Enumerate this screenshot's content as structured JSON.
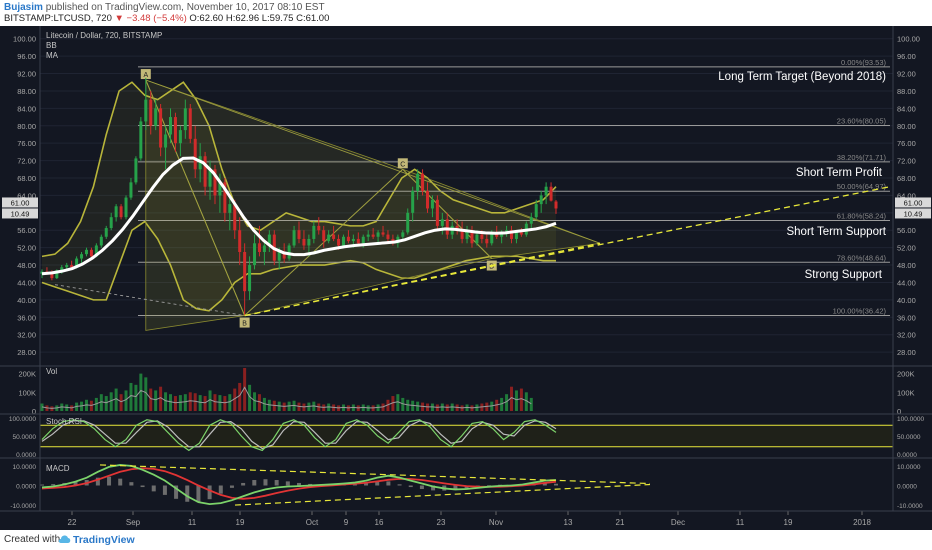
{
  "header": {
    "author": "Bujasim",
    "published": "published on TradingView.com, November 10, 2017 08:10 EST",
    "symbol_line": "BITSTAMP:LTCUSD, 720",
    "change": "▼ −3.48 (−5.4%)",
    "ohlc": "O:62.60 H:62.96 L:59.75 C:61.00"
  },
  "footer": {
    "created_with": "Created with",
    "brand": "TradingView"
  },
  "chart_data": [
    {
      "type": "line",
      "title": "Litecoin / Dollar, 720, BITSTAMP",
      "indicators": [
        "BB",
        "MA"
      ],
      "y_ticks": [
        "100.00",
        "96.00",
        "92.00",
        "88.00",
        "84.00",
        "80.00",
        "76.00",
        "72.00",
        "68.00",
        "64.00",
        "60.00",
        "56.00",
        "52.00",
        "48.00",
        "44.00",
        "40.00",
        "36.00",
        "32.00",
        "28.00"
      ],
      "ylim": [
        25.5,
        102
      ],
      "x_ticks": [
        "22",
        "Sep",
        "11",
        "19",
        "Oct",
        "9",
        "16",
        "23",
        "Nov",
        "13",
        "21",
        "Dec",
        "11",
        "19",
        "2018"
      ],
      "price_labels": {
        "last": "61.00",
        "ma": "10.49"
      },
      "fib_levels": [
        {
          "label": "0.00%(93.53)",
          "value": 93.53
        },
        {
          "label": "23.60%(80.05)",
          "value": 80.05
        },
        {
          "label": "38.20%(71.71)",
          "value": 71.71
        },
        {
          "label": "50.00%(64.97)",
          "value": 64.97
        },
        {
          "label": "61.80%(58.24)",
          "value": 58.24
        },
        {
          "label": "78.60%(48.64)",
          "value": 48.64
        },
        {
          "label": "100.00%(36.42)",
          "value": 36.42
        }
      ],
      "annotations": {
        "long_term": "Long Term Target (Beyond 2018)",
        "short_profit": "Short Term Profit",
        "short_support": "Short Term Support",
        "strong_support": "Strong Support"
      },
      "pattern_points": [
        {
          "label": "A",
          "value": 90.5
        },
        {
          "label": "B",
          "value": 36.4
        },
        {
          "label": "C",
          "value": 70.0
        },
        {
          "label": "D",
          "value": 49.5
        }
      ],
      "candles": [
        [
          46,
          47,
          45,
          46.5
        ],
        [
          46.5,
          47.5,
          45.8,
          46
        ],
        [
          46,
          46.8,
          44.5,
          45
        ],
        [
          45,
          47,
          44.8,
          46.8
        ],
        [
          46.8,
          48,
          46,
          47.5
        ],
        [
          47.5,
          48.5,
          47,
          48
        ],
        [
          48,
          49,
          47,
          47.5
        ],
        [
          47.5,
          50,
          47.2,
          49.5
        ],
        [
          49.5,
          51,
          48.5,
          50.5
        ],
        [
          50.5,
          52,
          50,
          51.5
        ],
        [
          51.5,
          52,
          49.5,
          50
        ],
        [
          50,
          53,
          49.8,
          52.5
        ],
        [
          52.5,
          55,
          52,
          54.5
        ],
        [
          54.5,
          57,
          54,
          56.5
        ],
        [
          56.5,
          60,
          56,
          59
        ],
        [
          59,
          62,
          58,
          61.5
        ],
        [
          61.5,
          62,
          58.5,
          59
        ],
        [
          59,
          64,
          58.5,
          63.5
        ],
        [
          63.5,
          68,
          63,
          67
        ],
        [
          67,
          73,
          66.5,
          72.5
        ],
        [
          72.5,
          82,
          72,
          81
        ],
        [
          81,
          91,
          79,
          86
        ],
        [
          86,
          88,
          78,
          80
        ],
        [
          80,
          86,
          79,
          84
        ],
        [
          84,
          85,
          73,
          75
        ],
        [
          75,
          80,
          70,
          78
        ],
        [
          78,
          84,
          76,
          82
        ],
        [
          82,
          83,
          74,
          76
        ],
        [
          76,
          80,
          73,
          79
        ],
        [
          79,
          86,
          77,
          84
        ],
        [
          84,
          85,
          76,
          77
        ],
        [
          77,
          80,
          68,
          70
        ],
        [
          70,
          76,
          67,
          73
        ],
        [
          73,
          74,
          64,
          66
        ],
        [
          66,
          72,
          63,
          70
        ],
        [
          70,
          71,
          62,
          64
        ],
        [
          64,
          69,
          60,
          67
        ],
        [
          67,
          68,
          58,
          60
        ],
        [
          60,
          64,
          56,
          62
        ],
        [
          62,
          63,
          54,
          56
        ],
        [
          56,
          59,
          48,
          51
        ],
        [
          51,
          53,
          36.4,
          42
        ],
        [
          42,
          50,
          40,
          48
        ],
        [
          48,
          55,
          47,
          53
        ],
        [
          53,
          57,
          50,
          51
        ],
        [
          51,
          54,
          48,
          52.5
        ],
        [
          52.5,
          56,
          51,
          55
        ],
        [
          55,
          56,
          48,
          49
        ],
        [
          49,
          52,
          47,
          51
        ],
        [
          51,
          53,
          48.5,
          49.5
        ],
        [
          49.5,
          53,
          49,
          52.5
        ],
        [
          52.5,
          57,
          52,
          56
        ],
        [
          56,
          58,
          53,
          54
        ],
        [
          54,
          56,
          51.5,
          52.5
        ],
        [
          52.5,
          55,
          50,
          54
        ],
        [
          54,
          58,
          53,
          57
        ],
        [
          57,
          59,
          55,
          56
        ],
        [
          56,
          57,
          52,
          53.5
        ],
        [
          53.5,
          56,
          53,
          55
        ],
        [
          55,
          57,
          53.5,
          54
        ],
        [
          54,
          55,
          51.5,
          52.5
        ],
        [
          52.5,
          55,
          52,
          54.5
        ],
        [
          54.5,
          56,
          53,
          53.5
        ],
        [
          53.5,
          55,
          52,
          54
        ],
        [
          54,
          55.5,
          52.5,
          53
        ],
        [
          53,
          55,
          52,
          54.5
        ],
        [
          54.5,
          56,
          53.5,
          55
        ],
        [
          55,
          56.5,
          54,
          54.5
        ],
        [
          54.5,
          56,
          53,
          55.5
        ],
        [
          55.5,
          57,
          54.5,
          55
        ],
        [
          55,
          56,
          53,
          54
        ],
        [
          54,
          55,
          52.5,
          53
        ],
        [
          53,
          55,
          52,
          54.5
        ],
        [
          54.5,
          56,
          54,
          55.5
        ],
        [
          55.5,
          61,
          55,
          60
        ],
        [
          60,
          66,
          58,
          65
        ],
        [
          65,
          70,
          63,
          69
        ],
        [
          69,
          70,
          64,
          65
        ],
        [
          65,
          67,
          60,
          61
        ],
        [
          61,
          64,
          59,
          63
        ],
        [
          63,
          64,
          56,
          57
        ],
        [
          57,
          60,
          55,
          58.5
        ],
        [
          58.5,
          60,
          54,
          55
        ],
        [
          55,
          58,
          54,
          57
        ],
        [
          57,
          58.5,
          55,
          56
        ],
        [
          56,
          58,
          53,
          54
        ],
        [
          54,
          57,
          53,
          56
        ],
        [
          56,
          57,
          52,
          53
        ],
        [
          53,
          56,
          52.5,
          55
        ],
        [
          55,
          56,
          53,
          54
        ],
        [
          54,
          55,
          52,
          53
        ],
        [
          53,
          56,
          52.5,
          55.5
        ],
        [
          55.5,
          57,
          54,
          54.5
        ],
        [
          54.5,
          56,
          53,
          55.5
        ],
        [
          55.5,
          57,
          54.5,
          56
        ],
        [
          56,
          57,
          53,
          54
        ],
        [
          54,
          56,
          53,
          55.5
        ],
        [
          55.5,
          56.5,
          54.5,
          55
        ],
        [
          55,
          58,
          54.5,
          57.5
        ],
        [
          57.5,
          60,
          56.5,
          59
        ],
        [
          59,
          63,
          58.5,
          62
        ],
        [
          62,
          65,
          60,
          64
        ],
        [
          64,
          67,
          62,
          66
        ],
        [
          66,
          67,
          62.6,
          62.8
        ],
        [
          62.6,
          62.96,
          59.75,
          61
        ]
      ],
      "ma": [
        46,
        46.2,
        46.6,
        47.2,
        48.2,
        49.6,
        51.4,
        53.6,
        56.2,
        59.2,
        62.5,
        65.8,
        68.8,
        71,
        72.5,
        72.6,
        71.5,
        69.2,
        66,
        62.5,
        59,
        56,
        53.6,
        51.8,
        50.8,
        50.4,
        50.4,
        50.8,
        51.4,
        51.8,
        52.2,
        52.5,
        52.7,
        52.9,
        53.1,
        53.3,
        53.8,
        54.6,
        55.4,
        56,
        56.3,
        56.2,
        55.9,
        55.6,
        55.4,
        55.3,
        55.4,
        55.7,
        56,
        56.3,
        56.8,
        57.6
      ],
      "bb_upper": [
        50,
        50.5,
        53,
        58,
        66,
        78,
        88,
        90,
        87,
        86,
        88,
        90,
        86,
        80,
        70,
        62,
        57,
        56,
        58,
        60,
        59,
        58,
        58,
        57.5,
        57,
        57,
        58,
        63,
        68,
        70,
        68,
        65,
        63,
        62,
        61,
        60,
        60,
        61,
        62,
        63,
        66
      ],
      "bb_lower": [
        44,
        43,
        42,
        41,
        40,
        40,
        48,
        56,
        58,
        54,
        48,
        40,
        38,
        37.5,
        40,
        44,
        46,
        46,
        47,
        47.5,
        48,
        48,
        48,
        48.5,
        49,
        48.5,
        47,
        46,
        45,
        45,
        46,
        47,
        48,
        49,
        49.5,
        50,
        50,
        50,
        49.5,
        49,
        49
      ],
      "trend_start_value": 43.5
    },
    {
      "type": "bar",
      "title": "Vol",
      "y_ticks": [
        "200K",
        "100K",
        "0"
      ],
      "ylim": [
        0,
        230000
      ],
      "values": [
        40000,
        30000,
        25000,
        30000,
        40000,
        35000,
        30000,
        45000,
        50000,
        60000,
        55000,
        70000,
        90000,
        80000,
        100000,
        120000,
        90000,
        110000,
        150000,
        140000,
        200000,
        180000,
        120000,
        110000,
        130000,
        100000,
        90000,
        80000,
        85000,
        90000,
        100000,
        95000,
        85000,
        80000,
        110000,
        90000,
        85000,
        80000,
        90000,
        120000,
        150000,
        230000,
        140000,
        100000,
        90000,
        70000,
        60000,
        55000,
        50000,
        45000,
        50000,
        55000,
        45000,
        40000,
        45000,
        50000,
        40000,
        35000,
        40000,
        35000,
        30000,
        35000,
        30000,
        35000,
        30000,
        35000,
        30000,
        30000,
        35000,
        40000,
        60000,
        80000,
        90000,
        70000,
        60000,
        55000,
        50000,
        45000,
        40000,
        40000,
        35000,
        40000,
        35000,
        40000,
        35000,
        30000,
        35000,
        30000,
        35000,
        40000,
        45000,
        50000,
        60000,
        70000,
        90000,
        130000,
        110000,
        120000,
        100000,
        70000
      ]
    },
    {
      "type": "line",
      "title": "Stoch RSI",
      "y_ticks": [
        "100.0000",
        "50.0000",
        "0.0000"
      ],
      "ylim": [
        0,
        100
      ],
      "levels": [
        80,
        20
      ],
      "k": [
        40,
        70,
        90,
        95,
        90,
        70,
        40,
        20,
        40,
        80,
        95,
        90,
        60,
        30,
        10,
        30,
        80,
        95,
        85,
        50,
        20,
        10,
        40,
        85,
        95,
        80,
        45,
        20,
        40,
        85,
        95,
        80,
        50,
        30,
        60,
        90,
        95,
        75,
        40,
        20,
        50,
        85,
        90,
        70,
        40,
        60,
        90,
        95,
        80,
        60
      ],
      "d": [
        35,
        55,
        80,
        92,
        92,
        80,
        55,
        30,
        30,
        60,
        88,
        92,
        75,
        45,
        20,
        20,
        55,
        88,
        90,
        70,
        35,
        15,
        25,
        65,
        90,
        88,
        60,
        30,
        30,
        65,
        90,
        88,
        65,
        40,
        45,
        78,
        92,
        85,
        55,
        30,
        35,
        70,
        88,
        80,
        55,
        50,
        80,
        92,
        88,
        70
      ]
    },
    {
      "type": "line",
      "title": "MACD",
      "y_ticks": [
        "10.0000",
        "0.0000",
        "-10.0000"
      ],
      "ylim": [
        -12,
        12
      ],
      "macd": [
        -1,
        -0.5,
        0.5,
        2,
        4,
        7,
        9.5,
        10.5,
        10,
        8,
        5.5,
        2.5,
        -1.5,
        -5.5,
        -8.5,
        -9.5,
        -9,
        -7.5,
        -5.5,
        -3.5,
        -2,
        -1,
        -0.5,
        -0.3,
        0,
        0.3,
        0.6,
        1,
        1.5,
        2.5,
        4,
        5,
        4,
        2.5,
        1,
        -0.5,
        -1.5,
        -2,
        -1.8,
        -1.2,
        -0.6,
        -0.2,
        0,
        0.5,
        1.5,
        2.5,
        2.8
      ],
      "signal": [
        -1.5,
        -1.2,
        -0.8,
        0,
        1.2,
        3,
        5,
        7,
        8.3,
        8.8,
        8.5,
        7.3,
        5.3,
        2.8,
        0,
        -2.5,
        -4.8,
        -6.3,
        -6.8,
        -6.3,
        -5.2,
        -3.8,
        -2.6,
        -1.6,
        -0.8,
        -0.3,
        0.1,
        0.5,
        0.9,
        1.4,
        2.1,
        2.9,
        3.4,
        3.3,
        2.8,
        2,
        1.1,
        0.3,
        -0.3,
        -0.6,
        -0.7,
        -0.6,
        -0.4,
        0,
        0.6,
        1.3,
        1.9
      ]
    }
  ]
}
